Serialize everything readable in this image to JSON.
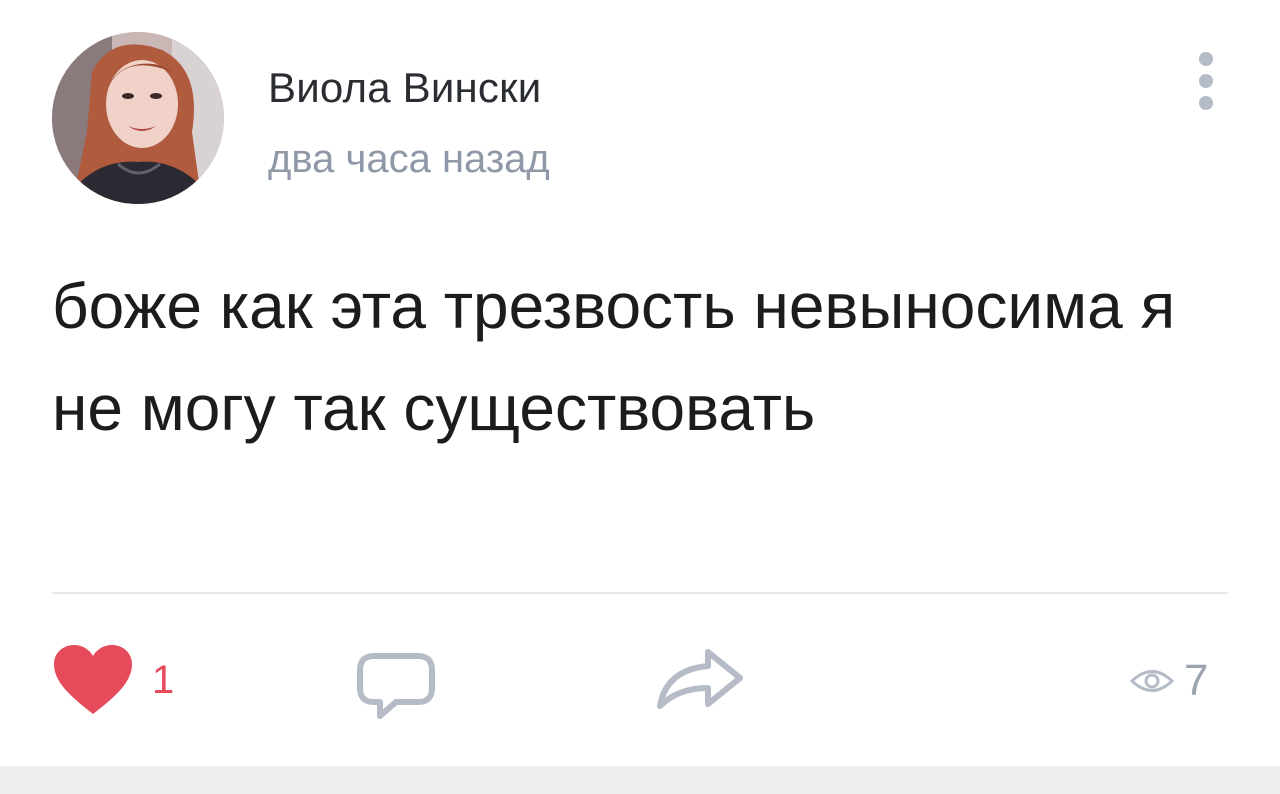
{
  "post": {
    "author": "Виола Вински",
    "time": "два часа назад",
    "text": "боже как эта трезвость невыносима я не могу так существовать",
    "likes": "1",
    "views": "7"
  },
  "icons": {
    "avatar": "avatar-photo",
    "more": "more-vertical-icon",
    "like": "heart-icon",
    "comment": "comment-icon",
    "share": "share-arrow-icon",
    "views": "eye-icon"
  },
  "colors": {
    "like_active": "#e64b5b",
    "secondary_text": "#8e98a6",
    "icon_gray": "#b5bcc7",
    "divider": "#e7e8ec",
    "background_strip": "#edeef0"
  }
}
